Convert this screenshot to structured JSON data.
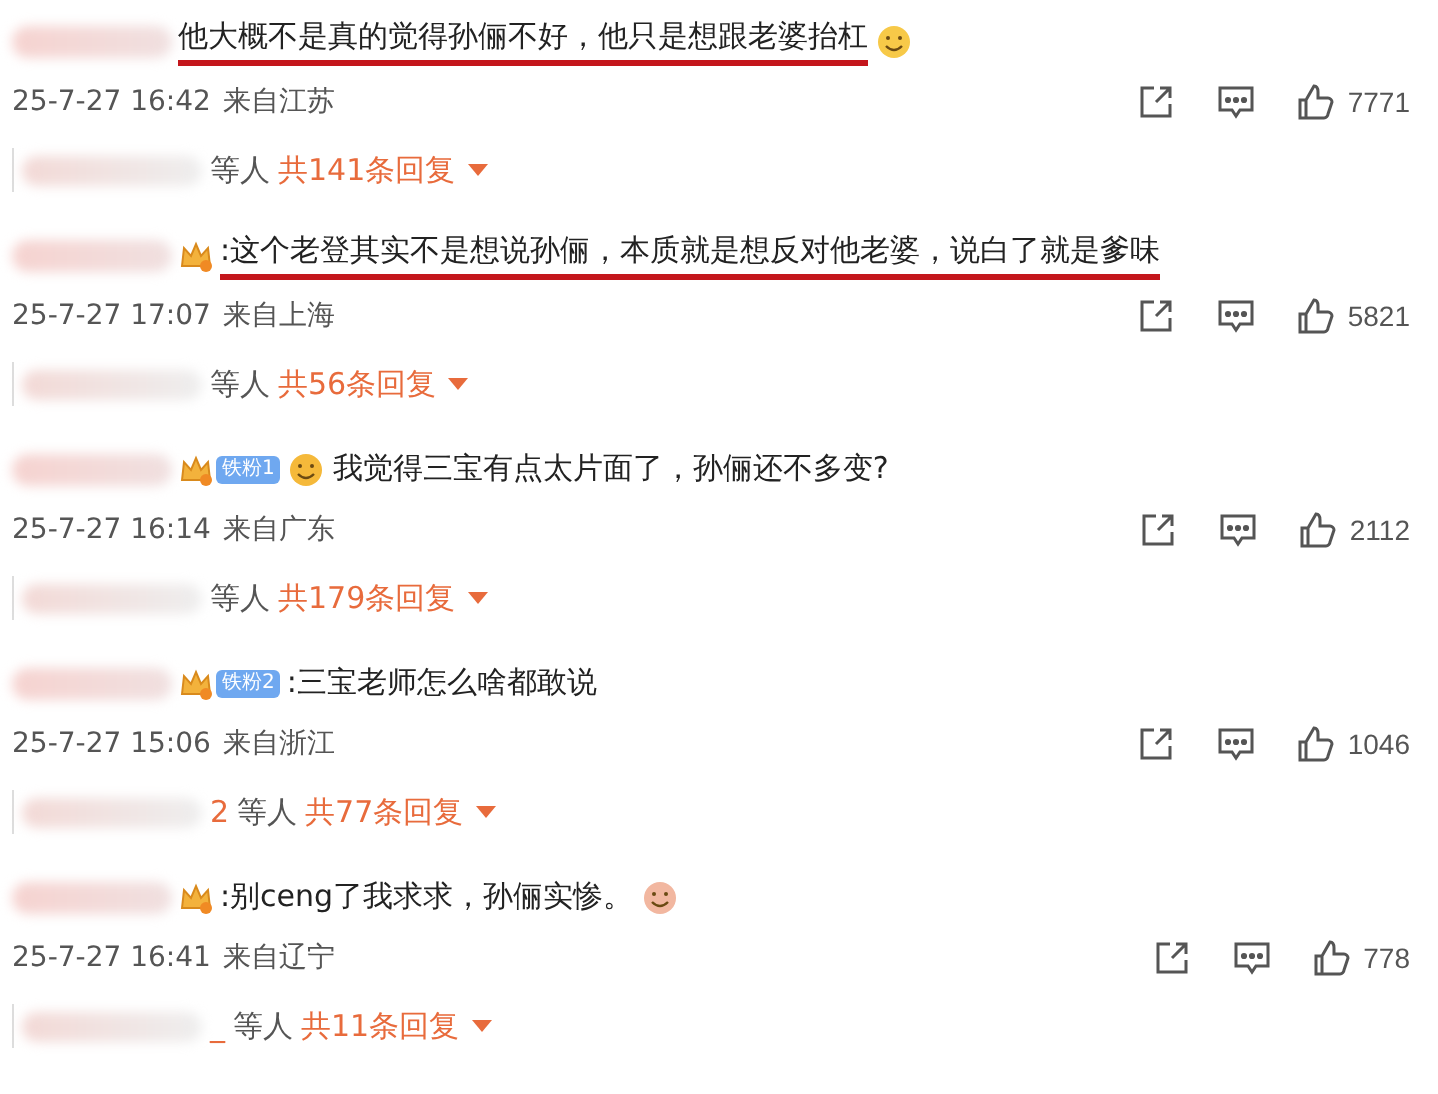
{
  "comments": [
    {
      "text": "他大概不是真的觉得孙俪不好，他只是想跟老婆抬杠",
      "emoji_after": {
        "kind": "shrug"
      },
      "underlined": true,
      "time": "25-7-27 16:42",
      "location": "来自江苏",
      "likes": "7771",
      "replies": {
        "suffix": "等人",
        "count": "共141条回复"
      }
    },
    {
      "badge": {
        "kind": "crown"
      },
      "text": ":这个老登其实不是想说孙俪，本质就是想反对他老婆，说白了就是爹味",
      "underlined": true,
      "time": "25-7-27 17:07",
      "location": "来自上海",
      "likes": "5821",
      "replies": {
        "suffix": "等人",
        "count": "共56条回复"
      }
    },
    {
      "badge": {
        "kind": "fan",
        "label": "铁粉1"
      },
      "emoji_before": {
        "kind": "laughing"
      },
      "text": "我觉得三宝有点太片面了，孙俪还不多变?",
      "underlined": false,
      "time": "25-7-27 16:14",
      "location": "来自广东",
      "likes": "2112",
      "replies": {
        "suffix": "等人",
        "count": "共179条回复"
      }
    },
    {
      "badge": {
        "kind": "fan",
        "label": "铁粉2"
      },
      "text": ":三宝老师怎么啥都敢说",
      "underlined": false,
      "time": "25-7-27 15:06",
      "location": "来自浙江",
      "likes": "1046",
      "replies": {
        "name_tail": "2",
        "suffix": "等人",
        "count": "共77条回复"
      }
    },
    {
      "badge": {
        "kind": "crown"
      },
      "text": ":别ceng了我求求，孙俪实惨。",
      "emoji_after": {
        "kind": "sticker"
      },
      "underlined": false,
      "time": "25-7-27 16:41",
      "location": "来自辽宁",
      "likes": "778",
      "replies": {
        "name_tail": "_",
        "suffix": "等人",
        "count": "共11条回复"
      }
    }
  ]
}
